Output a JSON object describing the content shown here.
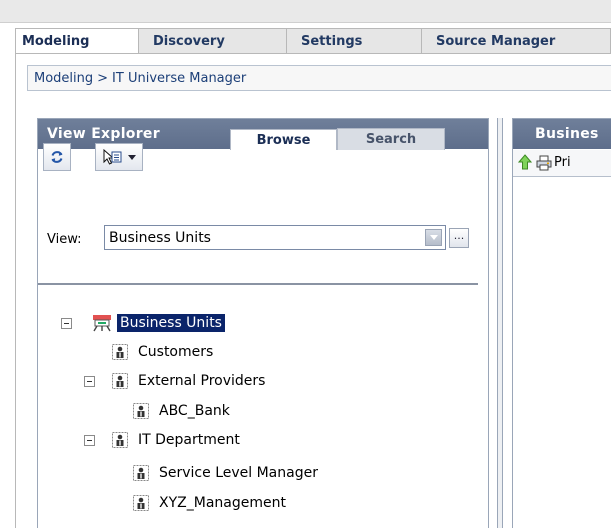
{
  "tabs": [
    "Modeling",
    "Discovery",
    "Settings",
    "Source Manager"
  ],
  "breadcrumb": {
    "root": "Modeling",
    "separator": ">",
    "current": "IT Universe Manager"
  },
  "view_explorer": {
    "title": "View Explorer",
    "tabs": {
      "browse": "Browse",
      "search": "Search"
    },
    "view_label": "View:",
    "view_value": "Business Units",
    "dots_label": "..."
  },
  "tree": [
    {
      "label": "Business Units",
      "icon": "business-units-icon"
    },
    {
      "label": "Customers",
      "icon": "business-unit-icon"
    },
    {
      "label": "External Providers",
      "icon": "business-unit-icon"
    },
    {
      "label": "ABC_Bank",
      "icon": "business-unit-icon"
    },
    {
      "label": "IT Department",
      "icon": "business-unit-icon"
    },
    {
      "label": "Service Level Manager",
      "icon": "business-unit-icon"
    },
    {
      "label": "XYZ_Management",
      "icon": "business-unit-icon"
    }
  ],
  "right_panel": {
    "title": "Busines",
    "print_label": "Pri"
  },
  "colors": {
    "header": "#5e6e8b",
    "selection": "#0a246a",
    "link": "#1c3f78"
  }
}
